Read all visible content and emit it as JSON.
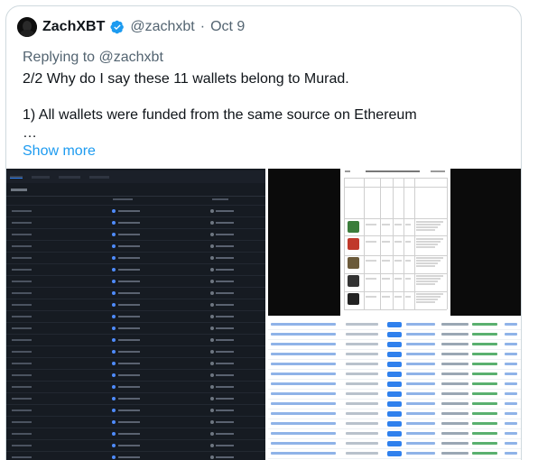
{
  "tweet": {
    "author_name": "ZachXBT",
    "handle": "@zachxbt",
    "separator": "·",
    "date": "Oct 9",
    "replying_label": "Replying to",
    "replying_to": "@zachxbt",
    "line1": "2/2 Why do I say these 11 wallets belong to Murad.",
    "line2": "1) All wallets were funded from the same source on Ethereum",
    "line3": "…",
    "show_more": "Show more"
  },
  "colors": {
    "link": "#1d9bf0",
    "secondary_text": "#536471",
    "verified": "#1d9bf0",
    "border": "#cfd9de"
  },
  "icons": {
    "verified": "verified-badge-icon",
    "avatar": "avatar"
  },
  "media": {
    "count": 3
  }
}
